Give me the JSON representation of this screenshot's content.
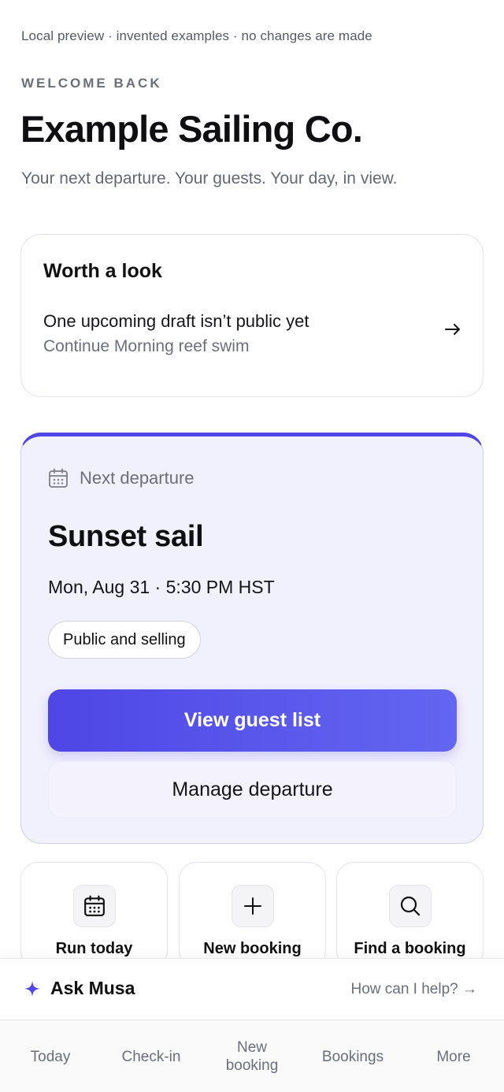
{
  "header": {
    "preview_note": "Local preview · invented examples · no changes are made",
    "eyebrow": "WELCOME BACK",
    "title": "Example Sailing Co.",
    "subtitle": "Your next departure. Your guests. Your day, in view."
  },
  "worth_a_look": {
    "heading": "Worth a look",
    "message": "One upcoming draft isn’t public yet",
    "detail": "Continue Morning reef swim",
    "icon": "arrow-right-icon"
  },
  "next_departure": {
    "label": "Next departure",
    "icon": "calendar-icon",
    "title": "Sunset sail",
    "datetime": "Mon, Aug 31 · 5:30 PM HST",
    "status": "Public and selling",
    "primary_action": "View guest list",
    "secondary_action": "Manage departure",
    "accent_color": "#4f46e5"
  },
  "quick_actions": [
    {
      "label": "Run today",
      "icon": "calendar-icon"
    },
    {
      "label": "New booking",
      "icon": "plus-icon"
    },
    {
      "label": "Find a booking",
      "icon": "search-icon"
    }
  ],
  "assistant": {
    "name": "Ask Musa",
    "icon": "sparkle-icon",
    "hint": "How can I help? →"
  },
  "tabbar": {
    "items": [
      {
        "label": "Today"
      },
      {
        "label": "Check-in"
      },
      {
        "label": "New booking"
      },
      {
        "label": "Bookings"
      },
      {
        "label": "More"
      }
    ]
  }
}
